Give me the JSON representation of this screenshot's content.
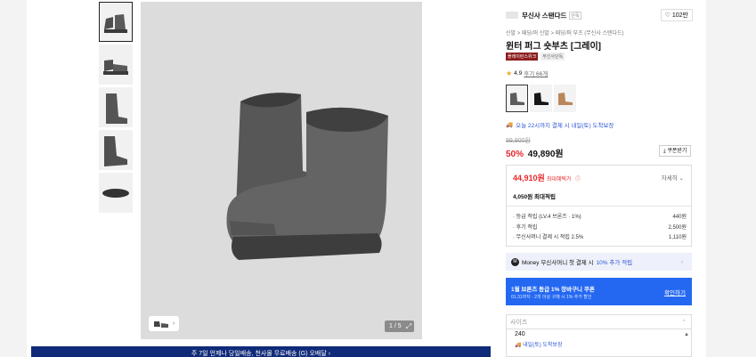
{
  "gallery": {
    "thumbnails": [
      "front-view",
      "side-view",
      "heel-view",
      "back-view",
      "sole-view"
    ],
    "pager": "1 / 5",
    "bottom_banner": "주 7일 언제나 당일배송, 천사몰 무료배송 (G) 오배달 ›"
  },
  "brand": {
    "logo_text": "MUSINSA STANDARD",
    "name": "무신사 스탠다드",
    "tag": "단독",
    "likes": "102만"
  },
  "product": {
    "breadcrumb": "신발 > 패딩/퍼 신발 > 패딩/퍼 부츠 (무신사 스탠다드)",
    "title": "윈터 퍼그 숏부츠 [그레이]",
    "badge_primary": "플래이런스위크",
    "badge_secondary": "무신사단독",
    "rating": "4.9",
    "reviews": "후기 66개",
    "swatches": [
      "gray",
      "black",
      "brown"
    ],
    "delivery_text": "오늘 22시까지 결제 시 내일(토) 도착보장",
    "original_price": "99,900원",
    "discount": "50%",
    "sale_price": "49,890원",
    "coupon_button": "쿠폰받기"
  },
  "benefits": {
    "best_price": "44,910원",
    "best_price_label": "최대혜택가",
    "detail_link": "자세히",
    "points_total": "4,050원 최대적립",
    "points": [
      {
        "label": "· 등급 적립 (LV.4 브론즈 · 1%)",
        "value": "440원"
      },
      {
        "label": "· 후기 적립",
        "value": "2,500원"
      },
      {
        "label": "· 무신사머니 결제 시 적립 2.5%",
        "value": "1,110원"
      }
    ]
  },
  "money_bar": {
    "prefix": "Money 무신사머니 첫 결제 시",
    "accent": "10% 추가 적립"
  },
  "coupon_banner": {
    "title": "1월 브론즈 등급 1% 장바구니 쿠폰",
    "subtitle": "01.31까지 · 2개 이상 구매 시 1% 추가 할인",
    "button": "확인하기"
  },
  "size": {
    "placeholder": "사이즈",
    "option": "240",
    "option_delivery": "내일(토) 도착보장"
  },
  "colors": {
    "accent_red": "#e9292c",
    "accent_blue": "#2468f2",
    "banner_navy": "#0f2a78"
  }
}
